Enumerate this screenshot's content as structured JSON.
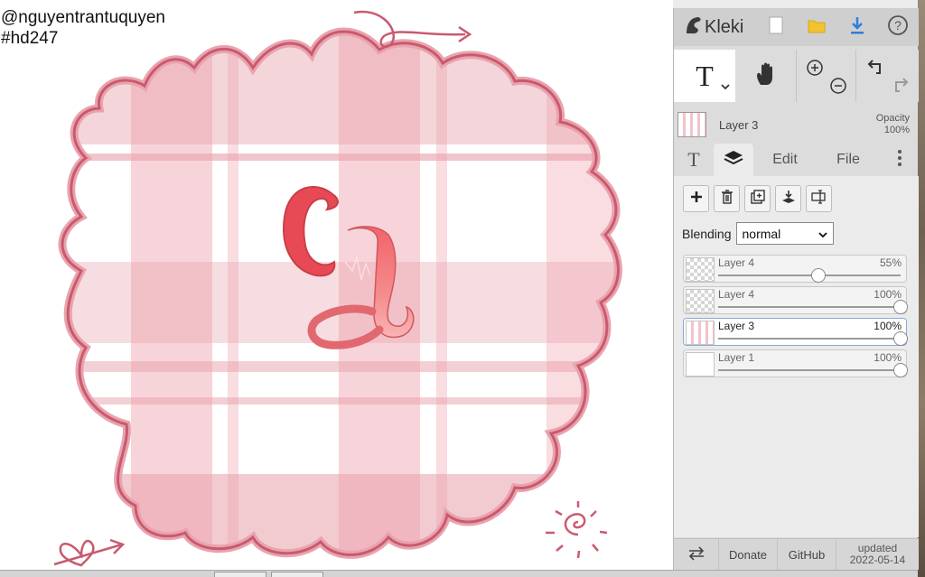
{
  "canvas": {
    "handle": "@nguyentrantuquyen",
    "hashtag": "#hd247"
  },
  "app": {
    "name": "Kleki",
    "icons": [
      "kleki-logo-icon",
      "new-image-icon",
      "open-folder-icon",
      "download-icon",
      "help-icon"
    ]
  },
  "toolbar": {
    "text_tool_glyph": "T",
    "tools": [
      "text-tool",
      "hand-tool",
      "zoom-in-out",
      "undo-redo"
    ]
  },
  "layer_info": {
    "name": "Layer 3",
    "opacity_label": "Opacity",
    "opacity_value": "100%"
  },
  "tabs": {
    "brush_glyph": "T",
    "edit": "Edit",
    "file": "File"
  },
  "layers_panel": {
    "blending_label": "Blending",
    "blending_value": "normal",
    "layers": [
      {
        "name": "Layer 4",
        "opacity": "55%",
        "level": 0.55,
        "selected": false
      },
      {
        "name": "Layer 4",
        "opacity": "100%",
        "level": 1.0,
        "selected": false
      },
      {
        "name": "Layer 3",
        "opacity": "100%",
        "level": 1.0,
        "selected": true
      },
      {
        "name": "Layer 1",
        "opacity": "100%",
        "level": 1.0,
        "selected": false
      }
    ]
  },
  "footer": {
    "donate": "Donate",
    "github": "GitHub",
    "updated_label": "updated",
    "updated_date": "2022-05-14"
  },
  "colors": {
    "accent_blue": "#2f7fd8",
    "folder_yellow": "#f2c230",
    "plaid_pink": "#f2cbd1",
    "border_rose": "#c95a6e",
    "letter_red": "#e84a55"
  }
}
